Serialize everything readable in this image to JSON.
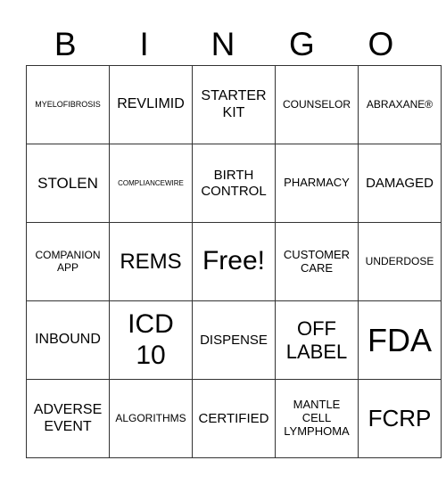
{
  "header": {
    "letters": [
      "B",
      "I",
      "N",
      "G",
      "O"
    ]
  },
  "cells": [
    [
      "MYELOFIBROSIS",
      "REVLIMID",
      "STARTER KIT",
      "COUNSELOR",
      "ABRAXANE®"
    ],
    [
      "STOLEN",
      "COMPLIANCEWIRE",
      "BIRTH CONTROL",
      "PHARMACY",
      "DAMAGED"
    ],
    [
      "COMPANION APP",
      "REMS",
      "Free!",
      "CUSTOMER CARE",
      "UNDERDOSE"
    ],
    [
      "INBOUND",
      "ICD 10",
      "DISPENSE",
      "OFF LABEL",
      "FDA"
    ],
    [
      "ADVERSE EVENT",
      "ALGORITHMS",
      "CERTIFIED",
      "MANTLE CELL LYMPHOMA",
      "FCRP"
    ]
  ]
}
